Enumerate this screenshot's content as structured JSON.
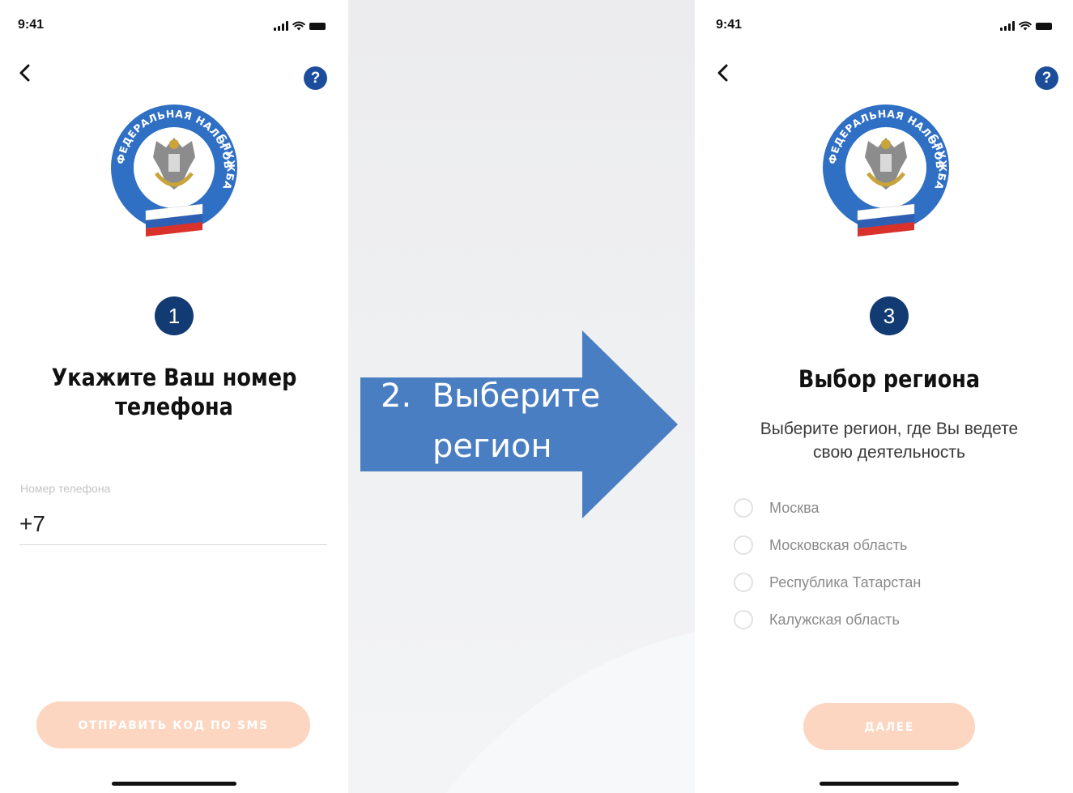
{
  "status_bar": {
    "time": "9:41"
  },
  "emblem": {
    "arc_text": "ФЕДЕРАЛЬНАЯ НАЛОГОВАЯ СЛУЖБА",
    "colors": {
      "ring": "#2f6fc4",
      "flag_white": "#ffffff",
      "flag_blue": "#2e5fb3",
      "flag_red": "#d8322b"
    }
  },
  "screen1": {
    "step_number": "1",
    "title_line1": "Укажите Ваш номер",
    "title_line2": "телефона",
    "phone_label": "Номер телефона",
    "phone_value": "+7",
    "submit_label": "ОТПРАВИТЬ КОД ПО SMS"
  },
  "transition": {
    "step_prefix": "2.",
    "line1": "Выберите",
    "line2": "регион",
    "arrow_color": "#4a7ec2"
  },
  "screen3": {
    "step_number": "3",
    "title": "Выбор региона",
    "subtitle_line1": "Выберите регион, где Вы ведете",
    "subtitle_line2": "свою деятельность",
    "regions": [
      {
        "label": "Москва",
        "selected": false
      },
      {
        "label": "Московская область",
        "selected": false
      },
      {
        "label": "Республика Татарстан",
        "selected": false
      },
      {
        "label": "Калужская область",
        "selected": false
      }
    ],
    "next_label": "ДАЛЕЕ"
  },
  "colors": {
    "accent_blue": "#1c4d9a",
    "badge_navy": "#123a73",
    "button_disabled": "#fcd6c0"
  }
}
